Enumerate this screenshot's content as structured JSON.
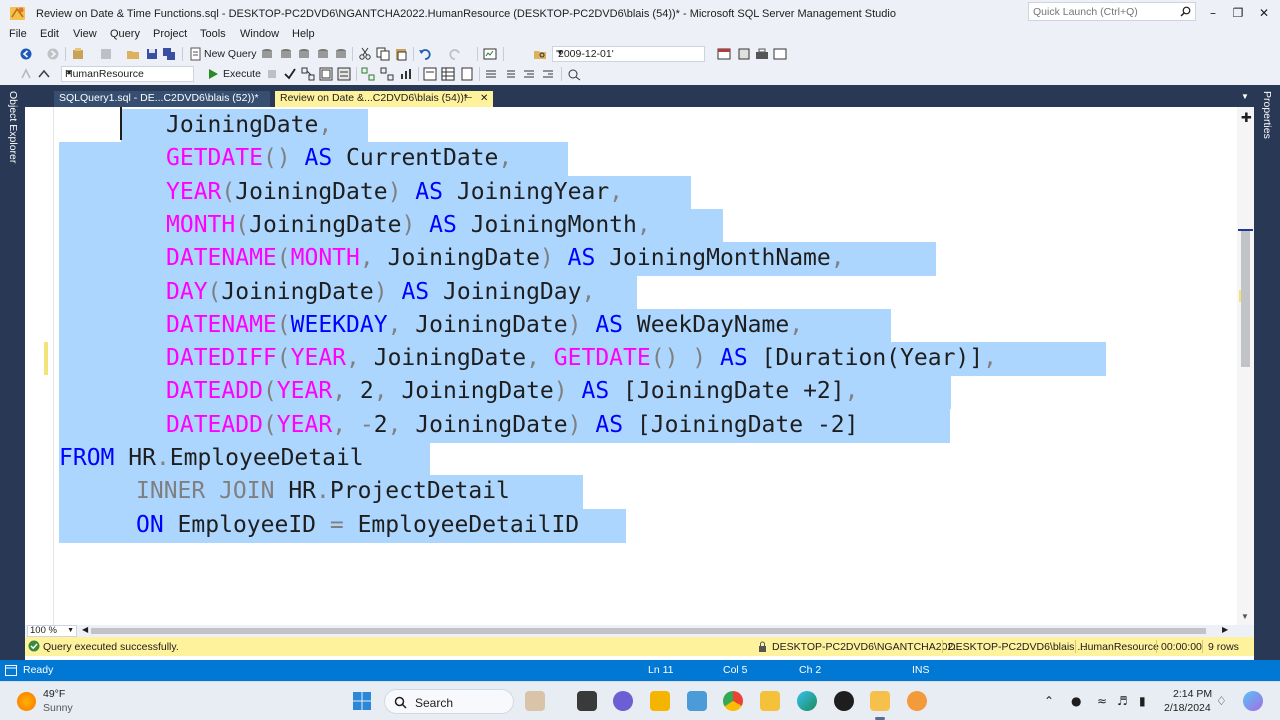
{
  "window": {
    "title": "Review on Date & Time Functions.sql - DESKTOP-PC2DVD6\\NGANTCHA2022.HumanResource (DESKTOP-PC2DVD6\\blais (54))* - Microsoft SQL Server Management Studio",
    "quick_launch_placeholder": "Quick Launch (Ctrl+Q)"
  },
  "menu": [
    "File",
    "Edit",
    "View",
    "Query",
    "Project",
    "Tools",
    "Window",
    "Help"
  ],
  "toolbar1": {
    "new_query_label": "New Query",
    "date_combo_value": "'2009-12-01'"
  },
  "toolbar2": {
    "database_combo_value": "HumanResource",
    "execute_label": "Execute"
  },
  "side_panels": {
    "left": "Object Explorer",
    "right": "Properties"
  },
  "tabs": [
    {
      "label": "SQLQuery1.sql - DE...C2DVD6\\blais (52))*",
      "active": false
    },
    {
      "label": "Review on Date &...C2DVD6\\blais (54))*",
      "active": true
    }
  ],
  "code_lines": [
    [
      {
        "t": "JoiningDate",
        "c": "ident"
      },
      {
        "t": ",",
        "c": "punct"
      }
    ],
    [
      {
        "t": "GETDATE",
        "c": "kw-fn"
      },
      {
        "t": "()",
        "c": "punct"
      },
      {
        "t": " ",
        "c": "ident"
      },
      {
        "t": "AS",
        "c": "kw-blue"
      },
      {
        "t": " CurrentDate",
        "c": "ident"
      },
      {
        "t": ",",
        "c": "punct"
      }
    ],
    [
      {
        "t": "YEAR",
        "c": "kw-fn"
      },
      {
        "t": "(",
        "c": "punct"
      },
      {
        "t": "JoiningDate",
        "c": "ident"
      },
      {
        "t": ")",
        "c": "punct"
      },
      {
        "t": " ",
        "c": "ident"
      },
      {
        "t": "AS",
        "c": "kw-blue"
      },
      {
        "t": " JoiningYear",
        "c": "ident"
      },
      {
        "t": ",",
        "c": "punct"
      }
    ],
    [
      {
        "t": "MONTH",
        "c": "kw-fn"
      },
      {
        "t": "(",
        "c": "punct"
      },
      {
        "t": "JoiningDate",
        "c": "ident"
      },
      {
        "t": ")",
        "c": "punct"
      },
      {
        "t": " ",
        "c": "ident"
      },
      {
        "t": "AS",
        "c": "kw-blue"
      },
      {
        "t": " JoiningMonth",
        "c": "ident"
      },
      {
        "t": ",",
        "c": "punct"
      }
    ],
    [
      {
        "t": "DATENAME",
        "c": "kw-fn"
      },
      {
        "t": "(",
        "c": "punct"
      },
      {
        "t": "MONTH",
        "c": "kw-fn"
      },
      {
        "t": ",",
        "c": "punct"
      },
      {
        "t": " JoiningDate",
        "c": "ident"
      },
      {
        "t": ")",
        "c": "punct"
      },
      {
        "t": " ",
        "c": "ident"
      },
      {
        "t": "AS",
        "c": "kw-blue"
      },
      {
        "t": " JoiningMonthName",
        "c": "ident"
      },
      {
        "t": ",",
        "c": "punct"
      }
    ],
    [
      {
        "t": "DAY",
        "c": "kw-fn"
      },
      {
        "t": "(",
        "c": "punct"
      },
      {
        "t": "JoiningDate",
        "c": "ident"
      },
      {
        "t": ")",
        "c": "punct"
      },
      {
        "t": " ",
        "c": "ident"
      },
      {
        "t": "AS",
        "c": "kw-blue"
      },
      {
        "t": " JoiningDay",
        "c": "ident"
      },
      {
        "t": ",",
        "c": "punct"
      }
    ],
    [
      {
        "t": "DATENAME",
        "c": "kw-fn"
      },
      {
        "t": "(",
        "c": "punct"
      },
      {
        "t": "WEEKDAY",
        "c": "kw-blue"
      },
      {
        "t": ",",
        "c": "punct"
      },
      {
        "t": " JoiningDate",
        "c": "ident"
      },
      {
        "t": ")",
        "c": "punct"
      },
      {
        "t": " ",
        "c": "ident"
      },
      {
        "t": "AS",
        "c": "kw-blue"
      },
      {
        "t": " WeekDayName",
        "c": "ident"
      },
      {
        "t": ",",
        "c": "punct"
      }
    ],
    [
      {
        "t": "DATEDIFF",
        "c": "kw-fn"
      },
      {
        "t": "(",
        "c": "punct"
      },
      {
        "t": "YEAR",
        "c": "kw-fn"
      },
      {
        "t": ",",
        "c": "punct"
      },
      {
        "t": " JoiningDate",
        "c": "ident"
      },
      {
        "t": ",",
        "c": "punct"
      },
      {
        "t": " ",
        "c": "ident"
      },
      {
        "t": "GETDATE",
        "c": "kw-fn"
      },
      {
        "t": "()",
        "c": "punct"
      },
      {
        "t": " ",
        "c": "ident"
      },
      {
        "t": ")",
        "c": "punct"
      },
      {
        "t": " ",
        "c": "ident"
      },
      {
        "t": "AS",
        "c": "kw-blue"
      },
      {
        "t": " [Duration(Year)]",
        "c": "ident"
      },
      {
        "t": ",",
        "c": "punct"
      }
    ],
    [
      {
        "t": "DATEADD",
        "c": "kw-fn"
      },
      {
        "t": "(",
        "c": "punct"
      },
      {
        "t": "YEAR",
        "c": "kw-fn"
      },
      {
        "t": ",",
        "c": "punct"
      },
      {
        "t": " 2",
        "c": "ident"
      },
      {
        "t": ",",
        "c": "punct"
      },
      {
        "t": " JoiningDate",
        "c": "ident"
      },
      {
        "t": ")",
        "c": "punct"
      },
      {
        "t": " ",
        "c": "ident"
      },
      {
        "t": "AS",
        "c": "kw-blue"
      },
      {
        "t": " [JoiningDate +2]",
        "c": "ident"
      },
      {
        "t": ",",
        "c": "punct"
      }
    ],
    [
      {
        "t": "DATEADD",
        "c": "kw-fn"
      },
      {
        "t": "(",
        "c": "punct"
      },
      {
        "t": "YEAR",
        "c": "kw-fn"
      },
      {
        "t": ",",
        "c": "punct"
      },
      {
        "t": " ",
        "c": "ident"
      },
      {
        "t": "-",
        "c": "punct"
      },
      {
        "t": "2",
        "c": "ident"
      },
      {
        "t": ",",
        "c": "punct"
      },
      {
        "t": " JoiningDate",
        "c": "ident"
      },
      {
        "t": ")",
        "c": "punct"
      },
      {
        "t": " ",
        "c": "ident"
      },
      {
        "t": "AS",
        "c": "kw-blue"
      },
      {
        "t": " [JoiningDate -2]",
        "c": "ident"
      }
    ],
    [
      {
        "t": "FROM",
        "c": "kw-blue"
      },
      {
        "t": " HR",
        "c": "ident"
      },
      {
        "t": ".",
        "c": "punct"
      },
      {
        "t": "EmployeeDetail",
        "c": "ident"
      }
    ],
    [
      {
        "t": "INNER JOIN",
        "c": "kw-gray"
      },
      {
        "t": " HR",
        "c": "ident"
      },
      {
        "t": ".",
        "c": "punct"
      },
      {
        "t": "ProjectDetail",
        "c": "ident"
      }
    ],
    [
      {
        "t": "ON",
        "c": "kw-blue"
      },
      {
        "t": " EmployeeID ",
        "c": "ident"
      },
      {
        "t": "=",
        "c": "punct"
      },
      {
        "t": " EmployeeDetailID",
        "c": "ident"
      }
    ]
  ],
  "editor": {
    "zoom": "100 %"
  },
  "query_status": {
    "message": "Query executed successfully.",
    "server": "DESKTOP-PC2DVD6\\NGANTCHA202...",
    "user": "DESKTOP-PC2DVD6\\blais ...",
    "database": "HumanResource",
    "elapsed": "00:00:00",
    "rows": "9 rows"
  },
  "status_bar": {
    "state": "Ready",
    "line": "Ln 11",
    "col": "Col 5",
    "ch": "Ch 2",
    "mode": "INS"
  },
  "taskbar": {
    "temperature": "49°F",
    "weather": "Sunny",
    "search_label": "Search",
    "time": "2:14 PM",
    "date": "2/18/2024"
  },
  "colors": {
    "selection": "#add6ff",
    "function_keyword": "#ff00ff",
    "keyword": "#0000ff",
    "operator_keyword": "#808080",
    "status_bar": "#0078d4",
    "query_status_bar": "#fff29d",
    "frame": "#293955"
  }
}
